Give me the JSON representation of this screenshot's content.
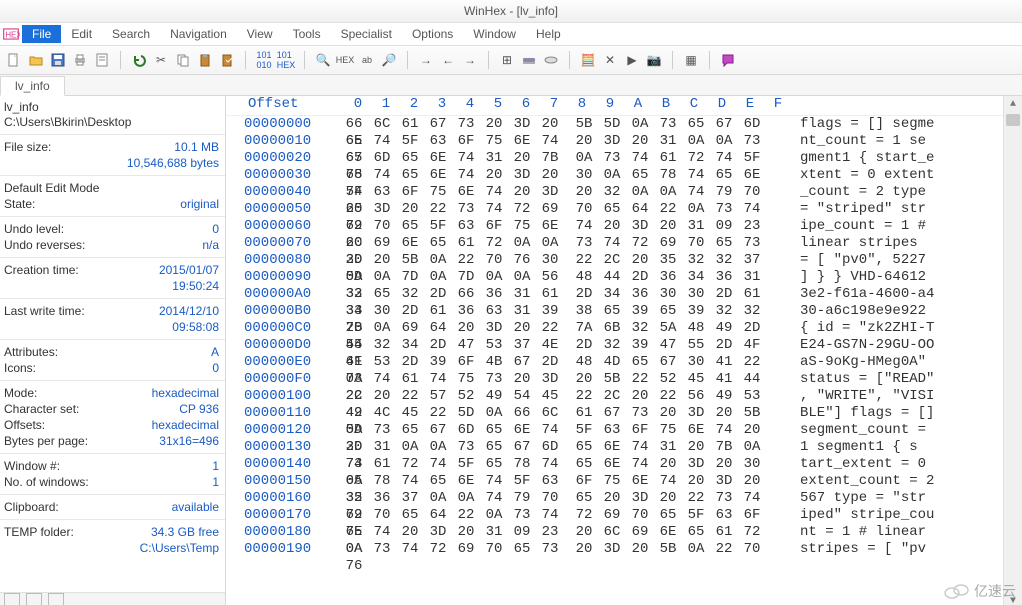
{
  "window": {
    "title": "WinHex - [lv_info]"
  },
  "menu": {
    "file": "File",
    "edit": "Edit",
    "search": "Search",
    "navigation": "Navigation",
    "view": "View",
    "tools": "Tools",
    "specialist": "Specialist",
    "options": "Options",
    "window": "Window",
    "help": "Help"
  },
  "tab": {
    "name": "lv_info"
  },
  "side": {
    "filename": "lv_info",
    "path": "C:\\Users\\Bkirin\\Desktop",
    "filesize_label": "File size:",
    "filesize_v1": "10.1 MB",
    "filesize_v2": "10,546,688 bytes",
    "editmode_label": "Default Edit Mode",
    "state_label": "State:",
    "state_v": "original",
    "undolevel_label": "Undo level:",
    "undolevel_v": "0",
    "undorev_label": "Undo reverses:",
    "undorev_v": "n/a",
    "ctime_label": "Creation time:",
    "ctime_v1": "2015/01/07",
    "ctime_v2": "19:50:24",
    "wtime_label": "Last write time:",
    "wtime_v1": "2014/12/10",
    "wtime_v2": "09:58:08",
    "attr_label": "Attributes:",
    "attr_v": "A",
    "icons_label": "Icons:",
    "icons_v": "0",
    "mode_label": "Mode:",
    "mode_v": "hexadecimal",
    "charset_label": "Character set:",
    "charset_v": "CP 936",
    "offsets_label": "Offsets:",
    "offsets_v": "hexadecimal",
    "bpp_label": "Bytes per page:",
    "bpp_v": "31x16=496",
    "winnum_label": "Window #:",
    "winnum_v": "1",
    "nwin_label": "No. of windows:",
    "nwin_v": "1",
    "clip_label": "Clipboard:",
    "clip_v": "available",
    "temp_label": "TEMP folder:",
    "temp_v1": "34.3 GB free",
    "temp_v2": "C:\\Users\\Temp"
  },
  "hex": {
    "offset_header": "Offset",
    "cols": [
      "0",
      "1",
      "2",
      "3",
      "4",
      "5",
      "6",
      "7",
      "8",
      "9",
      "A",
      "B",
      "C",
      "D",
      "E",
      "F"
    ],
    "rows": [
      {
        "off": "00000000",
        "b": [
          "66",
          "6C",
          "61",
          "67",
          "73",
          "20",
          "3D",
          "20",
          "5B",
          "5D",
          "0A",
          "73",
          "65",
          "67",
          "6D",
          "65"
        ],
        "a": "flags = [] segme"
      },
      {
        "off": "00000010",
        "b": [
          "6E",
          "74",
          "5F",
          "63",
          "6F",
          "75",
          "6E",
          "74",
          "20",
          "3D",
          "20",
          "31",
          "0A",
          "0A",
          "73",
          "65"
        ],
        "a": "nt_count = 1  se"
      },
      {
        "off": "00000020",
        "b": [
          "67",
          "6D",
          "65",
          "6E",
          "74",
          "31",
          "20",
          "7B",
          "0A",
          "73",
          "74",
          "61",
          "72",
          "74",
          "5F",
          "65"
        ],
        "a": "gment1 { start_e"
      },
      {
        "off": "00000030",
        "b": [
          "78",
          "74",
          "65",
          "6E",
          "74",
          "20",
          "3D",
          "20",
          "30",
          "0A",
          "65",
          "78",
          "74",
          "65",
          "6E",
          "74"
        ],
        "a": "xtent = 0 extent"
      },
      {
        "off": "00000040",
        "b": [
          "5F",
          "63",
          "6F",
          "75",
          "6E",
          "74",
          "20",
          "3D",
          "20",
          "32",
          "0A",
          "0A",
          "74",
          "79",
          "70",
          "65"
        ],
        "a": "_count = 2  type"
      },
      {
        "off": "00000050",
        "b": [
          "20",
          "3D",
          "20",
          "22",
          "73",
          "74",
          "72",
          "69",
          "70",
          "65",
          "64",
          "22",
          "0A",
          "73",
          "74",
          "72"
        ],
        "a": " = \"striped\" str"
      },
      {
        "off": "00000060",
        "b": [
          "69",
          "70",
          "65",
          "5F",
          "63",
          "6F",
          "75",
          "6E",
          "74",
          "20",
          "3D",
          "20",
          "31",
          "09",
          "23",
          "20"
        ],
        "a": "ipe_count = 1 # "
      },
      {
        "off": "00000070",
        "b": [
          "6C",
          "69",
          "6E",
          "65",
          "61",
          "72",
          "0A",
          "0A",
          "73",
          "74",
          "72",
          "69",
          "70",
          "65",
          "73",
          "20"
        ],
        "a": "linear  stripes "
      },
      {
        "off": "00000080",
        "b": [
          "3D",
          "20",
          "5B",
          "0A",
          "22",
          "70",
          "76",
          "30",
          "22",
          "2C",
          "20",
          "35",
          "32",
          "32",
          "37",
          "0A"
        ],
        "a": "= [ \"pv0\", 5227 "
      },
      {
        "off": "00000090",
        "b": [
          "5D",
          "0A",
          "7D",
          "0A",
          "7D",
          "0A",
          "0A",
          "56",
          "48",
          "44",
          "2D",
          "36",
          "34",
          "36",
          "31",
          "32"
        ],
        "a": "] } }  VHD-64612"
      },
      {
        "off": "000000A0",
        "b": [
          "33",
          "65",
          "32",
          "2D",
          "66",
          "36",
          "31",
          "61",
          "2D",
          "34",
          "36",
          "30",
          "30",
          "2D",
          "61",
          "34"
        ],
        "a": "3e2-f61a-4600-a4"
      },
      {
        "off": "000000B0",
        "b": [
          "33",
          "30",
          "2D",
          "61",
          "36",
          "63",
          "31",
          "39",
          "38",
          "65",
          "39",
          "65",
          "39",
          "32",
          "32",
          "20"
        ],
        "a": "30-a6c198e9e922 "
      },
      {
        "off": "000000C0",
        "b": [
          "7B",
          "0A",
          "69",
          "64",
          "20",
          "3D",
          "20",
          "22",
          "7A",
          "6B",
          "32",
          "5A",
          "48",
          "49",
          "2D",
          "54"
        ],
        "a": "{ id = \"zk2ZHI-T"
      },
      {
        "off": "000000D0",
        "b": [
          "45",
          "32",
          "34",
          "2D",
          "47",
          "53",
          "37",
          "4E",
          "2D",
          "32",
          "39",
          "47",
          "55",
          "2D",
          "4F",
          "4F"
        ],
        "a": "E24-GS7N-29GU-OO"
      },
      {
        "off": "000000E0",
        "b": [
          "61",
          "53",
          "2D",
          "39",
          "6F",
          "4B",
          "67",
          "2D",
          "48",
          "4D",
          "65",
          "67",
          "30",
          "41",
          "22",
          "0A"
        ],
        "a": "aS-9oKg-HMeg0A\" "
      },
      {
        "off": "000000F0",
        "b": [
          "73",
          "74",
          "61",
          "74",
          "75",
          "73",
          "20",
          "3D",
          "20",
          "5B",
          "22",
          "52",
          "45",
          "41",
          "44",
          "22"
        ],
        "a": "status = [\"READ\""
      },
      {
        "off": "00000100",
        "b": [
          "2C",
          "20",
          "22",
          "57",
          "52",
          "49",
          "54",
          "45",
          "22",
          "2C",
          "20",
          "22",
          "56",
          "49",
          "53",
          "49"
        ],
        "a": ", \"WRITE\", \"VISI"
      },
      {
        "off": "00000110",
        "b": [
          "42",
          "4C",
          "45",
          "22",
          "5D",
          "0A",
          "66",
          "6C",
          "61",
          "67",
          "73",
          "20",
          "3D",
          "20",
          "5B",
          "5D"
        ],
        "a": "BLE\"] flags = []"
      },
      {
        "off": "00000120",
        "b": [
          "0A",
          "73",
          "65",
          "67",
          "6D",
          "65",
          "6E",
          "74",
          "5F",
          "63",
          "6F",
          "75",
          "6E",
          "74",
          "20",
          "3D"
        ],
        "a": " segment_count ="
      },
      {
        "off": "00000130",
        "b": [
          "20",
          "31",
          "0A",
          "0A",
          "73",
          "65",
          "67",
          "6D",
          "65",
          "6E",
          "74",
          "31",
          "20",
          "7B",
          "0A",
          "73"
        ],
        "a": " 1  segment1 { s"
      },
      {
        "off": "00000140",
        "b": [
          "74",
          "61",
          "72",
          "74",
          "5F",
          "65",
          "78",
          "74",
          "65",
          "6E",
          "74",
          "20",
          "3D",
          "20",
          "30",
          "0A"
        ],
        "a": "tart_extent = 0 "
      },
      {
        "off": "00000150",
        "b": [
          "65",
          "78",
          "74",
          "65",
          "6E",
          "74",
          "5F",
          "63",
          "6F",
          "75",
          "6E",
          "74",
          "20",
          "3D",
          "20",
          "32"
        ],
        "a": "extent_count = 2"
      },
      {
        "off": "00000160",
        "b": [
          "35",
          "36",
          "37",
          "0A",
          "0A",
          "74",
          "79",
          "70",
          "65",
          "20",
          "3D",
          "20",
          "22",
          "73",
          "74",
          "72"
        ],
        "a": "567  type = \"str"
      },
      {
        "off": "00000170",
        "b": [
          "69",
          "70",
          "65",
          "64",
          "22",
          "0A",
          "73",
          "74",
          "72",
          "69",
          "70",
          "65",
          "5F",
          "63",
          "6F",
          "75"
        ],
        "a": "iped\" stripe_cou"
      },
      {
        "off": "00000180",
        "b": [
          "6E",
          "74",
          "20",
          "3D",
          "20",
          "31",
          "09",
          "23",
          "20",
          "6C",
          "69",
          "6E",
          "65",
          "61",
          "72",
          "0A"
        ],
        "a": "nt = 1 # linear "
      },
      {
        "off": "00000190",
        "b": [
          "0A",
          "73",
          "74",
          "72",
          "69",
          "70",
          "65",
          "73",
          "20",
          "3D",
          "20",
          "5B",
          "0A",
          "22",
          "70",
          "76"
        ],
        "a": " stripes = [ \"pv"
      }
    ]
  },
  "watermark": "亿速云"
}
